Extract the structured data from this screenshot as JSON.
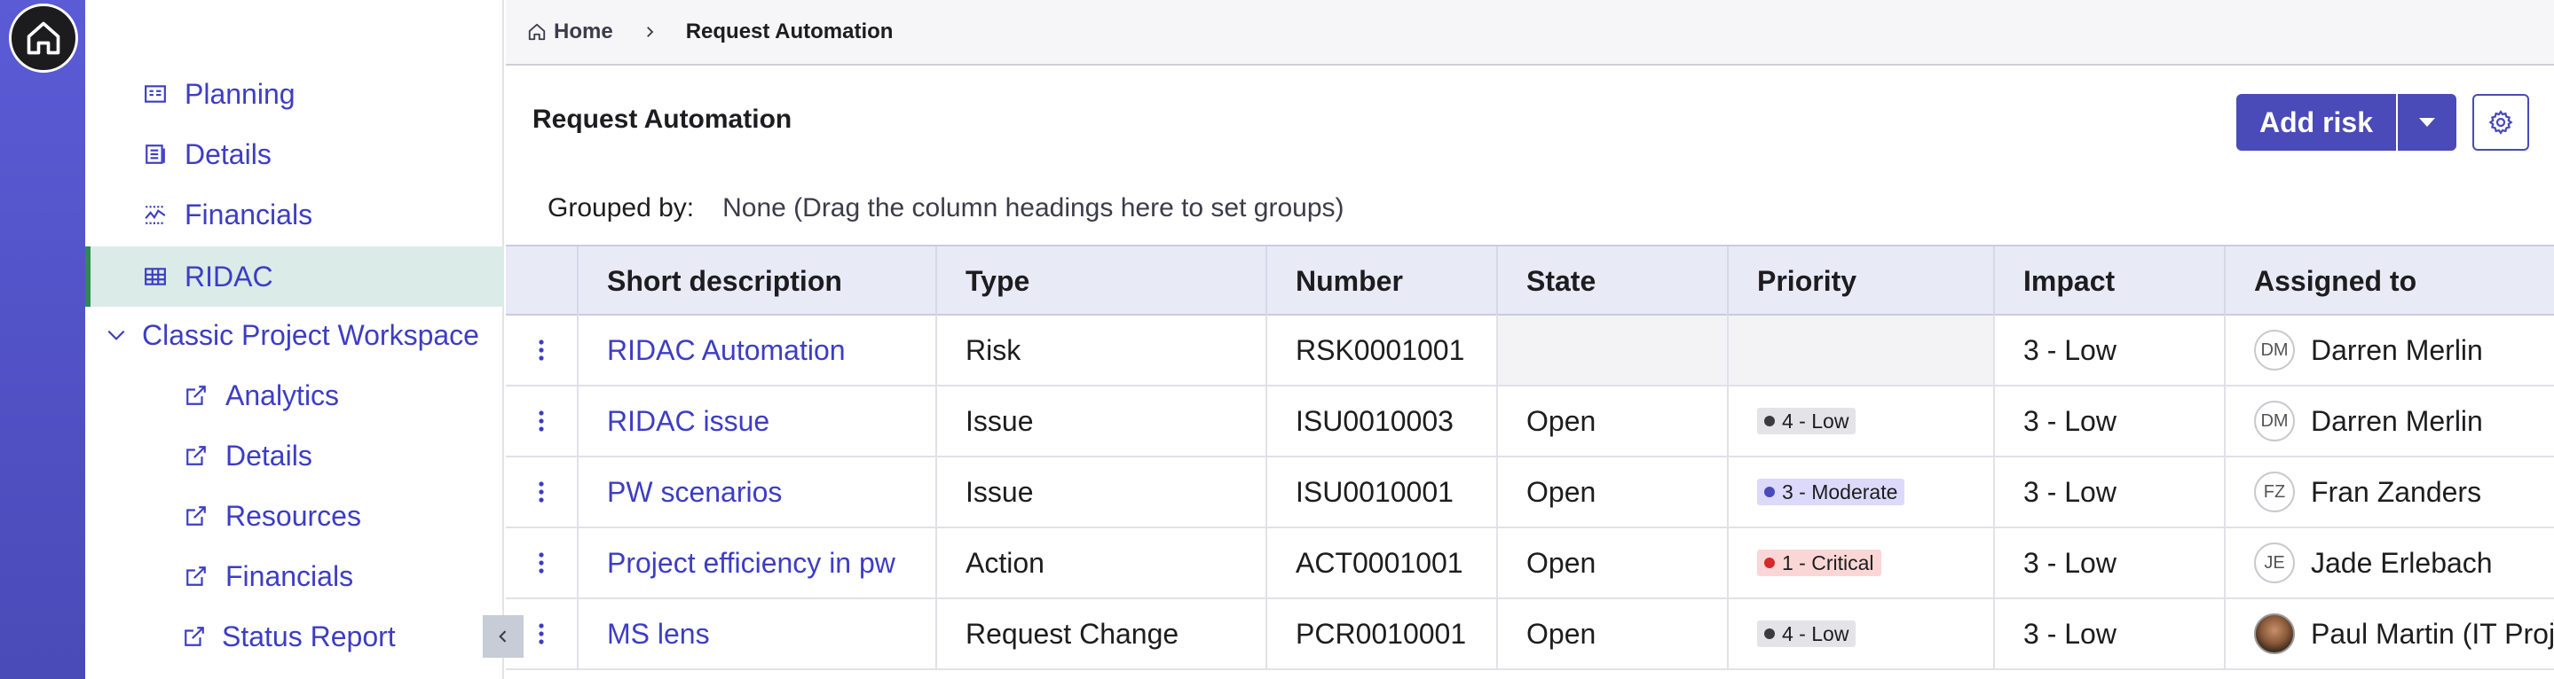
{
  "breadcrumb": {
    "home": "Home",
    "current": "Request Automation"
  },
  "nav": {
    "items": [
      {
        "label": "Planning",
        "icon": "planning-icon"
      },
      {
        "label": "Details",
        "icon": "details-icon"
      },
      {
        "label": "Financials",
        "icon": "financials-icon"
      },
      {
        "label": "RIDAC",
        "icon": "table-icon",
        "active": true
      },
      {
        "label": "Classic Project Workspace",
        "icon": "chevron-down-icon"
      },
      {
        "label": "Analytics",
        "icon": "external-link-icon"
      },
      {
        "label": "Details",
        "icon": "external-link-icon"
      },
      {
        "label": "Resources",
        "icon": "external-link-icon"
      },
      {
        "label": "Financials",
        "icon": "external-link-icon"
      },
      {
        "label": "Status Report",
        "icon": "external-link-icon"
      }
    ]
  },
  "header": {
    "title": "Request Automation",
    "add_label": "Add risk"
  },
  "grouped": {
    "label": "Grouped by:",
    "value": "None (Drag the column headings here to set groups)"
  },
  "table": {
    "columns": [
      "Short description",
      "Type",
      "Number",
      "State",
      "Priority",
      "Impact",
      "Assigned to"
    ],
    "rows": [
      {
        "desc": "RIDAC Automation",
        "type": "Risk",
        "number": "RSK0001001",
        "state": "",
        "priority": "",
        "impact": "3 - Low",
        "initials": "DM",
        "assigned": "Darren Merlin"
      },
      {
        "desc": "RIDAC issue",
        "type": "Issue",
        "number": "ISU0010003",
        "state": "Open",
        "priority": "4 - Low",
        "impact": "3 - Low",
        "initials": "DM",
        "assigned": "Darren Merlin"
      },
      {
        "desc": "PW scenarios",
        "type": "Issue",
        "number": "ISU0010001",
        "state": "Open",
        "priority": "3 - Moderate",
        "impact": "3 - Low",
        "initials": "FZ",
        "assigned": "Fran Zanders"
      },
      {
        "desc": "Project efficiency in pw",
        "type": "Action",
        "number": "ACT0001001",
        "state": "Open",
        "priority": "1 - Critical",
        "impact": "3 - Low",
        "initials": "JE",
        "assigned": "Jade Erlebach"
      },
      {
        "desc": "MS lens",
        "type": "Request Change",
        "number": "PCR0010001",
        "state": "Open",
        "priority": "4 - Low",
        "impact": "3 - Low",
        "initials": "",
        "assigned": "Paul Martin (IT Proje"
      }
    ]
  },
  "colors": {
    "accent": "#4a4ab8",
    "rail": "#5b5bd6",
    "link": "#3d3dc4",
    "active_nav_bg": "#dbece8",
    "active_nav_bar": "#2d8a55",
    "priority_low_bg": "#e4e4e8",
    "priority_low_dot": "#3a3a40",
    "priority_moderate_bg": "#ddd9fb",
    "priority_moderate_dot": "#4a4ab8",
    "priority_critical_bg": "#fbd6d6",
    "priority_critical_dot": "#d42a2a"
  }
}
